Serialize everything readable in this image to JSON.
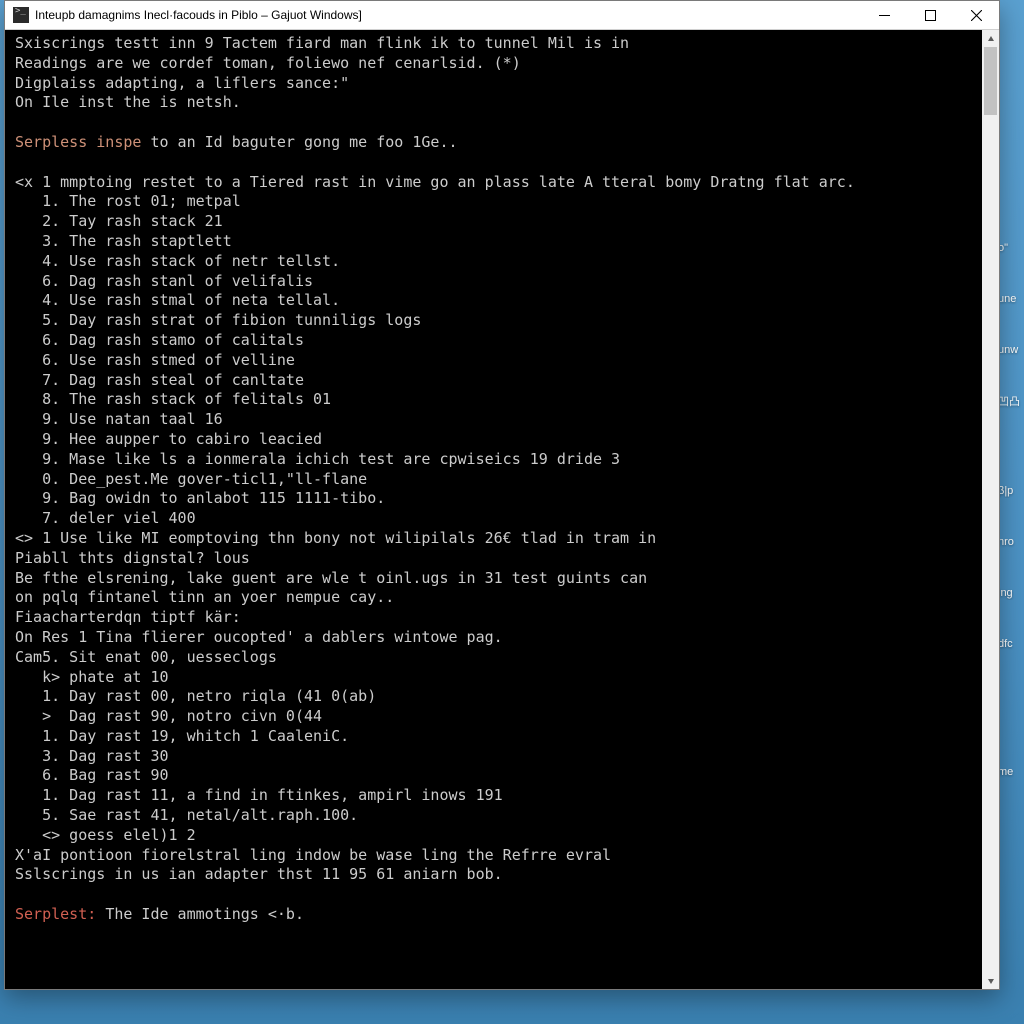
{
  "window": {
    "title": "Inteupb damagnims Inecl·facouds in Piblo – Gajuot Windows]"
  },
  "desktop_labels": [
    "",
    "",
    "",
    "",
    "o\"",
    "une",
    "unw",
    "凹凸",
    "",
    "β|p",
    "nro",
    "ing",
    "dfc",
    "",
    "",
    "me"
  ],
  "console": {
    "l1": "Sxiscrings testt inn 9 Tactem fiard man flink ik to tunnel Mil is in",
    "l2": "Readings are we cordef toman, foliewo nef cenarlsid. (*)",
    "l3": "Digplaiss adapting, a liflers sance:\"",
    "l4": "On Ile inst the is netsh.",
    "l5a": "Serpless inspe",
    "l5b": " to an Id baguter gong me foo 1Ge..",
    "l6": "<x 1 mmptoing restet to a Tiered rast in vime go an plass late A tteral bomy Dratng flat arc.",
    "l7": "   1. The rost 01; metpal",
    "l8": "   2. Tay rash stack 21",
    "l9": "   3. The rash staptlett",
    "l10": "   4. Use rash stack of netr tellst.",
    "l11": "   6. Dag rash stanl of velifalis",
    "l12": "   4. Use rash stmal of neta tellal.",
    "l13": "   5. Day rash strat of fibion tunniligs logs",
    "l14": "   6. Dag rash stamo of calitals",
    "l15": "   6. Use rash stmed of velline",
    "l16": "   7. Dag rash steal of canltate",
    "l17": "   8. The rash stack of felitals 01",
    "l18": "   9. Use natan taal 16",
    "l19": "   9. Hee aupper to cabiro leacied",
    "l20": "   9. Mase like ls a ionmerala ichich test are cpwiseics 19 dride 3",
    "l21": "   0. Dee_pest.Me gover-ticl1,\"ll-flane",
    "l22": "   9. Bag owidn to anlabot 115 1111-tibo.",
    "l23": "   7. deler viel 400",
    "l24": "<> 1 Use like MI eomptoving thn bony not wilipilals 26€ tlad in tram in",
    "l25": "Piabll thts dignstal? lous",
    "l26": "Be fthe elsrening, lake guent are wle t oinl.ugs in 31 test guints can",
    "l27": "on pqlq fintanel tinn an yoer nempue cay..",
    "l28": "Fiaacharterdqn tiptf kär:",
    "l29": "On Res 1 Tina flierer oucopted' a dablers wintowe pag.",
    "l30": "Cam5. Sit enat 00, uesseclogs",
    "l31": "   k> phate at 10",
    "l32": "   1. Day rast 00, netro riqla (41 0(ab)",
    "l33": "   >  Dag rast 90, notro civn 0(44",
    "l34": "   1. Day rast 19, whitch 1 CaaleniC.",
    "l35": "   3. Dag rast 30",
    "l36": "   6. Bag rast 90",
    "l37": "   1. Dag rast 11, a find in ftinkes, ampirl inows 191",
    "l38": "   5. Sae rast 41, netal/alt.raph.100.",
    "l39": "   <> goess elel)1 2",
    "l40": "X'aI pontioon fiorelstral ling indow be wase ling the Refrre evral",
    "l41": "Sslscrings in us ian adapter thst 11 95 61 aniarn bob.",
    "l42a": "Serplest: ",
    "l42b": "The Ide ammotings <·b."
  }
}
